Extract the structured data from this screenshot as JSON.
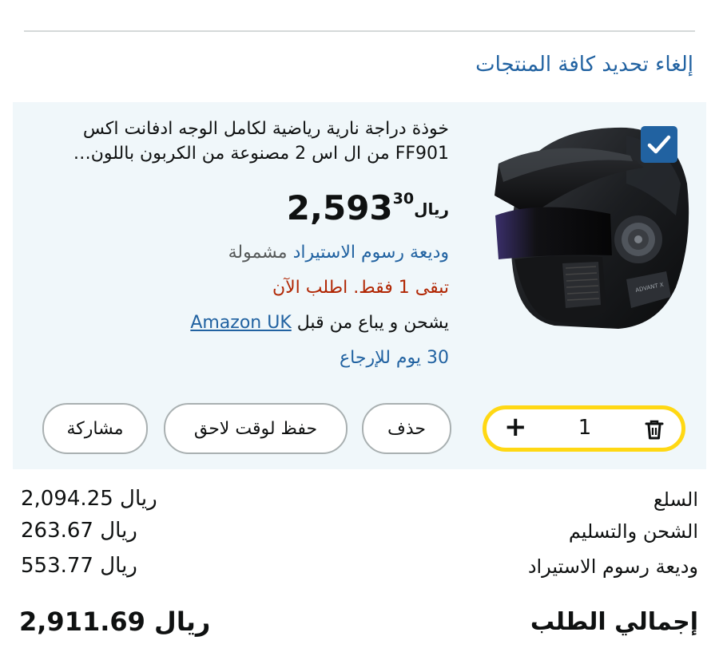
{
  "header": {
    "deselect_all": "إلغاء تحديد كافة المنتجات"
  },
  "item": {
    "title": "خوذة دراجة نارية رياضية لكامل الوجه ادفانت اكس FF901 من ال اس 2 مصنوعة من الكربون باللون…",
    "selected": true,
    "price": {
      "currency": "ريال",
      "whole": "2,593",
      "fraction": "30"
    },
    "deposit": {
      "link": "وديعة رسوم الاستيراد",
      "suffix": "مشمولة"
    },
    "stock": "تبقى 1 فقط. اطلب الآن",
    "shipped": {
      "prefix": "يشحن و يباع من قبل",
      "seller": "Amazon UK"
    },
    "returns": "30 يوم للإرجاع",
    "image_icon": "helmet-image",
    "quantity": "1",
    "actions": {
      "delete": "حذف",
      "save_later": "حفظ لوقت لاحق",
      "share": "مشاركة"
    }
  },
  "summary": {
    "rows": [
      {
        "label": "السلع",
        "value": "2,094.25 ريال"
      },
      {
        "label": "الشحن والتسليم",
        "value": "263.67 ريال"
      },
      {
        "label": "وديعة رسوم الاستيراد",
        "value": "553.77 ريال"
      }
    ],
    "total": {
      "label": "إجمالي الطلب",
      "value": "2,911.69 ريال"
    }
  },
  "colors": {
    "link": "#2162a1",
    "stock_red": "#b12704",
    "qty_border": "#ffd814",
    "card_bg": "#f0f7fa",
    "checkbox": "#2162a1"
  }
}
